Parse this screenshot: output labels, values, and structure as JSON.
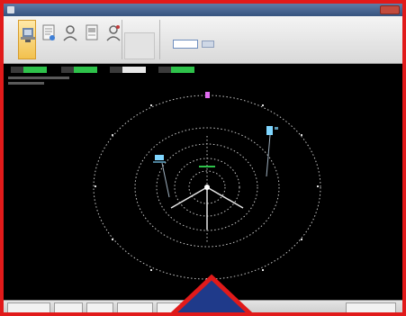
{
  "window": {
    "title": "",
    "close_label": ""
  },
  "ribbon": {
    "tools": [
      {
        "name": "tool-1",
        "label": "",
        "icon": "radar-dish-icon",
        "active": true
      },
      {
        "name": "tool-2",
        "label": "",
        "icon": "document-icon",
        "active": false
      },
      {
        "name": "tool-3",
        "label": "",
        "icon": "user-icon",
        "active": false
      },
      {
        "name": "tool-4",
        "label": "",
        "icon": "document-icon",
        "active": false
      },
      {
        "name": "tool-5",
        "label": "",
        "icon": "user-icon",
        "active": false
      }
    ],
    "group_caption": "",
    "settings_caption": "",
    "settings_value": "",
    "settings_button": ""
  },
  "display": {
    "readouts": [
      {
        "label": "",
        "value": "",
        "accent": "#2ec24a"
      },
      {
        "label": "",
        "value": "",
        "accent": "#2ec24a"
      },
      {
        "label": "",
        "value": "",
        "accent": "#e8e8e8"
      },
      {
        "label": "",
        "value": "",
        "accent": "#2ec24a"
      }
    ],
    "info_lines": [
      "",
      ""
    ]
  },
  "statusbar": {
    "cells": [
      "",
      "",
      "",
      "",
      "",
      ""
    ]
  },
  "colors": {
    "frame_border": "#e11a1a",
    "scope_grid": "#c8c8c8",
    "target_cyan": "#7fd6ff",
    "marker_magenta": "#e06cf0",
    "readout_green": "#2ec24a",
    "overlay_fill": "#1f3a8a",
    "overlay_border": "#e11a1a"
  }
}
